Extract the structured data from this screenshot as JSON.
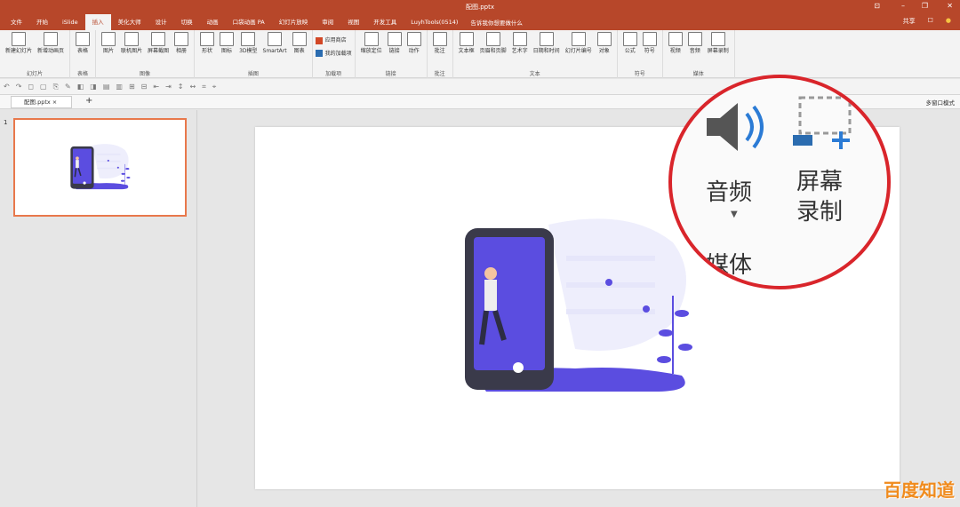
{
  "window": {
    "title": "配图.pptx",
    "share": "共享",
    "controls": [
      "⊡",
      "–",
      "❐",
      "✕"
    ]
  },
  "tabs": [
    "文件",
    "开始",
    "iSlide",
    "插入",
    "美化大师",
    "设计",
    "切换",
    "动画",
    "口袋动画 PA",
    "幻灯片放映",
    "审阅",
    "视图",
    "开发工具",
    "LuyhTools(0514)"
  ],
  "active_tab": "插入",
  "tell_me": "告诉我你想要做什么",
  "ribbon": [
    {
      "label": "幻灯片",
      "buttons": [
        "新建幻灯片",
        "新增动画页"
      ]
    },
    {
      "label": "表格",
      "buttons": [
        "表格"
      ]
    },
    {
      "label": "图像",
      "buttons": [
        "图片",
        "联机图片",
        "屏幕截图",
        "相册"
      ]
    },
    {
      "label": "插图",
      "buttons": [
        "形状",
        "图标",
        "3D模型",
        "SmartArt",
        "图表"
      ]
    },
    {
      "label": "加载项",
      "small": [
        "应用商店",
        "我的加载项"
      ]
    },
    {
      "label": "链接",
      "buttons": [
        "缩放定位",
        "链接",
        "动作"
      ]
    },
    {
      "label": "批注",
      "buttons": [
        "批注"
      ]
    },
    {
      "label": "文本",
      "buttons": [
        "文本框",
        "页眉和页脚",
        "艺术字",
        "日期和时间",
        "幻灯片编号",
        "对象"
      ]
    },
    {
      "label": "符号",
      "buttons": [
        "公式",
        "符号"
      ]
    },
    {
      "label": "媒体",
      "buttons": [
        "视频",
        "音频",
        "屏幕录制"
      ]
    }
  ],
  "doc_tab": "配图.pptx",
  "multi_window": "多窗口模式",
  "slide_number": "1",
  "callout": {
    "audio": "音频",
    "record_line1": "屏幕",
    "record_line2": "录制",
    "group": "媒体"
  },
  "watermark": "百度知道",
  "colors": {
    "accent": "#b7472a",
    "callout": "#d9252b",
    "illustration": "#5b4de0"
  }
}
